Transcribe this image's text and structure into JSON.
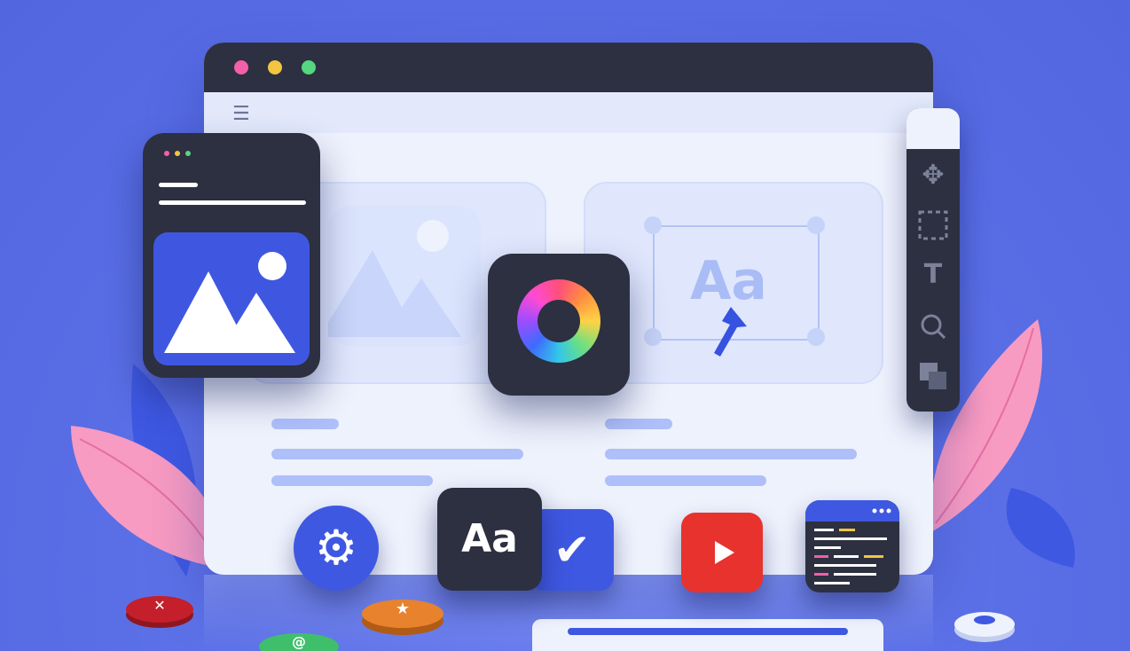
{
  "colors": {
    "background": "#5a6fe6",
    "dark_panel": "#2d3040",
    "accent_blue": "#3f58e2",
    "window_light": "#eef2fd",
    "traffic_light_red": "#f35fa8",
    "traffic_light_yellow": "#f2c541",
    "traffic_light_green": "#55d680",
    "youtube_red": "#e8322d",
    "feather_pink": "#f79bc2"
  },
  "icons": {
    "menu": "hamburger-icon",
    "image": "mountain-image-icon",
    "color_wheel": "color-wheel-icon",
    "move": "move-icon",
    "select": "marquee-select-icon",
    "text_tool": "text-tool-icon",
    "search": "search-icon",
    "layers": "layers-icon",
    "settings": "gear-icon",
    "check": "checkmark-icon",
    "play": "play-icon",
    "code": "code-icon",
    "close": "close-icon",
    "star": "star-icon",
    "at": "at-icon",
    "cursor": "cursor-arrow-icon"
  },
  "glyphs": {
    "hamburger": "☰",
    "move": "✥",
    "text_tool": "T",
    "search": "⚲",
    "gear": "⚙",
    "check": "✔",
    "close": "✕",
    "star": "★",
    "at": "@"
  },
  "labels": {
    "font_sample_canvas": "Aa",
    "font_sample_tile": "Aa"
  }
}
